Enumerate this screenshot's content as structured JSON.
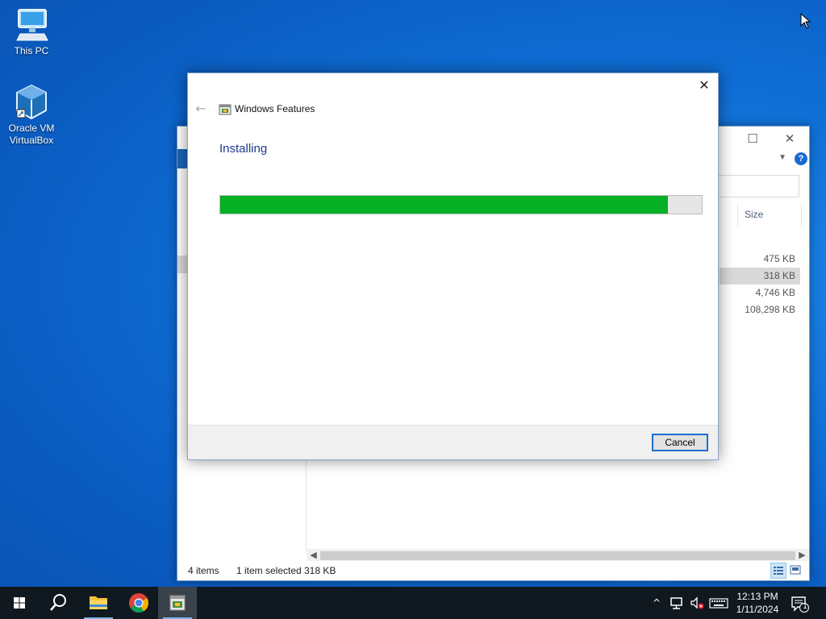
{
  "desktop": {
    "icons": [
      {
        "label": "This PC"
      },
      {
        "label": "Oracle VM VirtualBox"
      }
    ]
  },
  "explorer": {
    "controls": {
      "maximize": "☐",
      "close": "✕"
    },
    "help_label": "?",
    "column_header": "Size",
    "sizes": [
      "475 KB",
      "318 KB",
      "4,746 KB",
      "108,298 KB"
    ],
    "selected_index": 1,
    "status": {
      "item_count": "4 items",
      "selected": "1 item selected",
      "selected_size": "318 KB"
    }
  },
  "dialog": {
    "title": "Windows Features",
    "heading": "Installing",
    "progress_percent": 93,
    "cancel_label": "Cancel",
    "back_glyph": "←",
    "close_glyph": "✕"
  },
  "taskbar": {
    "clock_time": "12:13 PM",
    "clock_date": "1/11/2024",
    "notification_count": "1",
    "tray_chevron": "^"
  },
  "colors": {
    "desktop_bg": "#0f6fd6",
    "progress_fill": "#06b025",
    "taskbar_bg": "#101820",
    "accent": "#1e6fd0"
  }
}
